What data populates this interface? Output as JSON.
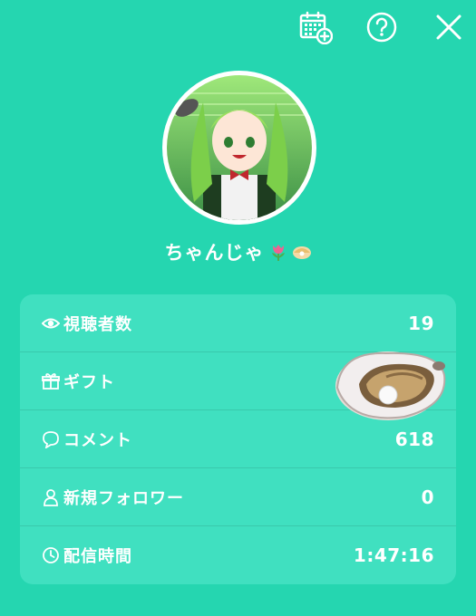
{
  "header": {
    "calendar_icon": "calendar-add-icon",
    "help_icon": "question-circle-icon",
    "close_icon": "close-icon"
  },
  "profile": {
    "username": "ちゃんじゃ",
    "emojis": [
      "tulip",
      "oyster"
    ]
  },
  "stats": [
    {
      "icon": "eye-icon",
      "label": "視聴者数",
      "value": "19"
    },
    {
      "icon": "gift-icon",
      "label": "ギフト",
      "value": ""
    },
    {
      "icon": "comment-icon",
      "label": "コメント",
      "value": "618"
    },
    {
      "icon": "person-icon",
      "label": "新規フォロワー",
      "value": "0"
    },
    {
      "icon": "clock-icon",
      "label": "配信時間",
      "value": "1:47:16"
    }
  ],
  "colors": {
    "background": "#25d6b0",
    "card": "#40e0c0",
    "text": "#ffffff"
  }
}
